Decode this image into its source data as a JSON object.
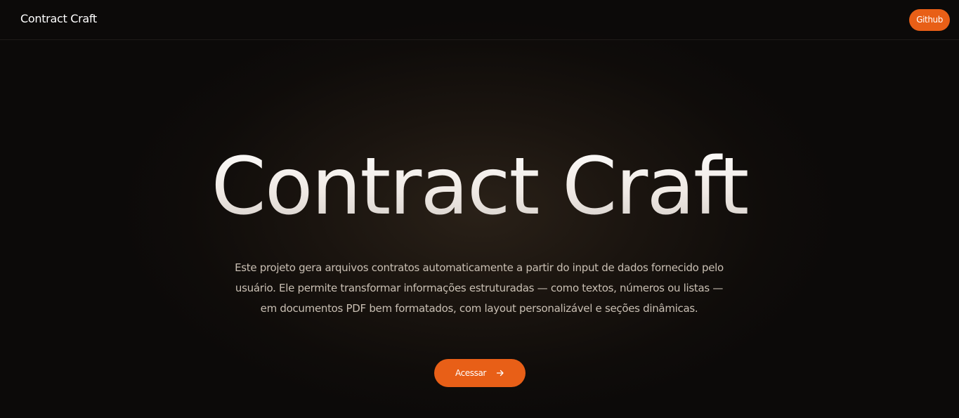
{
  "navbar": {
    "brand": "Contract Craft",
    "github_label": "Github"
  },
  "hero": {
    "title": "Contract Craft",
    "description": "Este projeto gera arquivos contratos automaticamente a partir do input de dados fornecido pelo usuário. Ele permite transformar informações estruturadas — como textos, números ou listas — em documentos PDF bem formatados, com layout personalizável e seções dinâmicas.",
    "cta_label": "Acessar",
    "cta_icon": "arrow-right-icon"
  },
  "colors": {
    "accent": "#e85f17",
    "background": "#0d0b0a",
    "text_muted": "#c9bfb3"
  }
}
